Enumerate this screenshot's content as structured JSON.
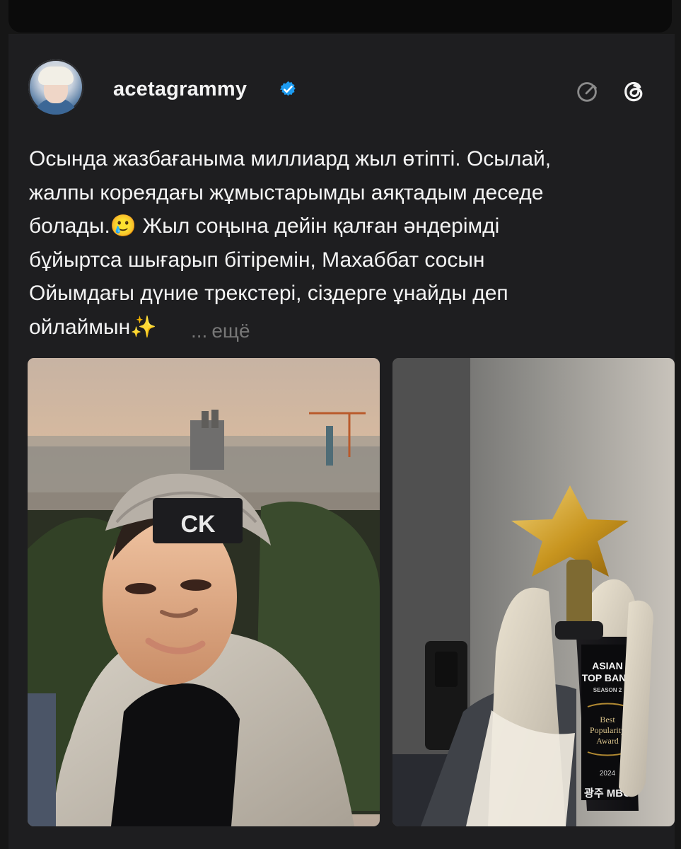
{
  "post": {
    "author": {
      "username": "acetagrammy",
      "verified": true,
      "avatar": "avatar"
    },
    "actions": {
      "compose_icon": "compose-icon",
      "threads_icon": "threads-icon"
    },
    "text": "Осында жазбағаныма миллиард жыл өтіпті. Осылай,\nжалпы кореядағы жұмыстарымды аяқтадым деседе\nболады.🥲 Жыл соңына дейін қалған әндерімді\nбұйыртса шығарып бітіремін, Махаббат сосын\nОйымдағы дүние трекстері, сіздерге ұнайды деп\nойлаймын✨",
    "more": {
      "ellipsis": "...",
      "label": "ещё"
    },
    "images": [
      {
        "name": "selfie-photo",
        "cap_logo": "CK"
      },
      {
        "name": "award-photo",
        "award_text": {
          "line1": "ASIAN",
          "line2": "TOP BAND",
          "line3": "SEASON 2",
          "line4": "Best",
          "line5": "Popularity",
          "line6": "Award",
          "line7": "2024",
          "line8": "광주 MBC"
        }
      }
    ]
  },
  "theme": {
    "background": "#161616",
    "card": "#1e1e20",
    "text": "#f4f4f4",
    "muted": "#777777",
    "verified": "#1d9bf0"
  }
}
